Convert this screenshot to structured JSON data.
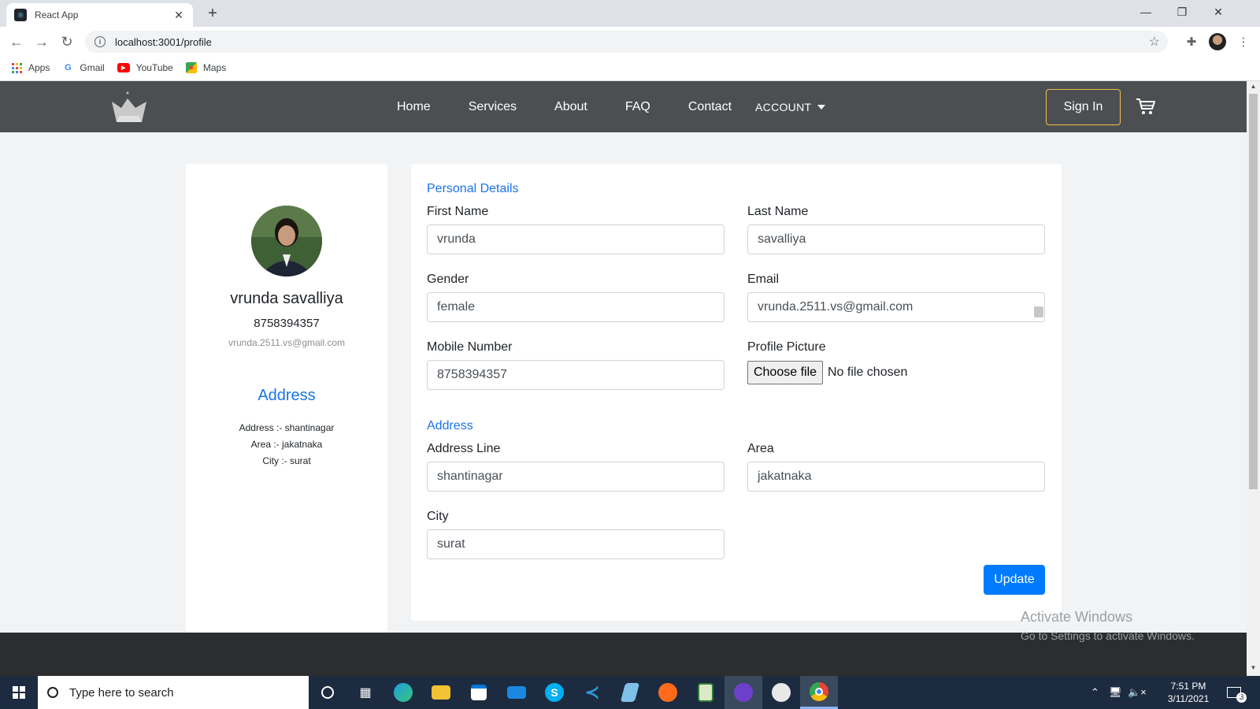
{
  "browser": {
    "tab_title": "React App",
    "url": "localhost:3001/profile",
    "bookmarks": [
      {
        "label": "Apps",
        "icon": "apps-grid-icon"
      },
      {
        "label": "Gmail",
        "icon": "google-icon"
      },
      {
        "label": "YouTube",
        "icon": "youtube-icon"
      },
      {
        "label": "Maps",
        "icon": "maps-icon"
      }
    ]
  },
  "navbar": {
    "links": [
      "Home",
      "Services",
      "About",
      "FAQ",
      "Contact"
    ],
    "account_label": "ACCOUNT",
    "signin_label": "Sign In",
    "accent": "#f0c14b"
  },
  "profile_card": {
    "name": "vrunda savalliya",
    "phone": "8758394357",
    "email": "vrunda.2511.vs@gmail.com",
    "address_heading": "Address",
    "address_lines": [
      "Address :- shantinagar",
      "Area :- jakatnaka",
      "City :- surat"
    ]
  },
  "form": {
    "personal_heading": "Personal Details",
    "first_name_label": "First Name",
    "first_name": "vrunda",
    "last_name_label": "Last Name",
    "last_name": "savalliya",
    "gender_label": "Gender",
    "gender": "female",
    "email_label": "Email",
    "email": "vrunda.2511.vs@gmail.com",
    "mobile_label": "Mobile Number",
    "mobile": "8758394357",
    "picture_label": "Profile Picture",
    "choose_file_label": "Choose file",
    "no_file_text": "No file chosen",
    "address_heading": "Address",
    "address_line_label": "Address Line",
    "address_line": "shantinagar",
    "area_label": "Area",
    "area": "jakatnaka",
    "city_label": "City",
    "city": "surat",
    "update_label": "Update"
  },
  "watermark": {
    "line1": "Activate Windows",
    "line2": "Go to Settings to activate Windows."
  },
  "taskbar": {
    "search_placeholder": "Type here to search",
    "time": "7:51 PM",
    "date": "3/11/2021",
    "notification_count": "3"
  }
}
